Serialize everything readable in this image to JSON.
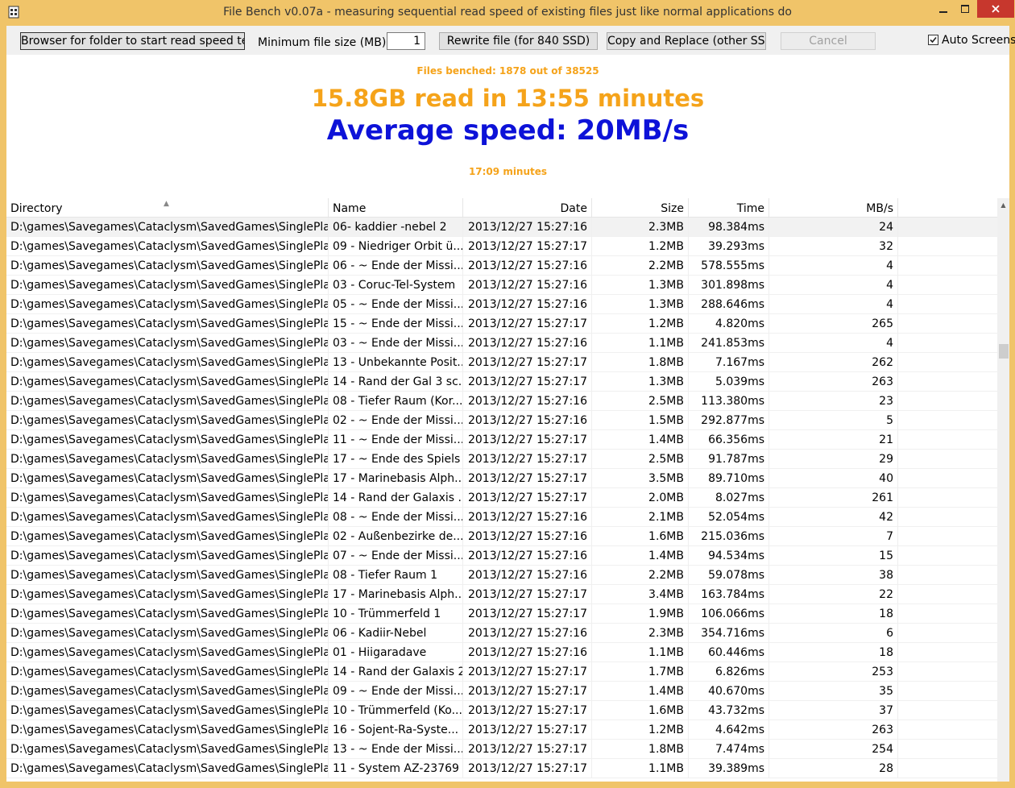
{
  "window": {
    "title": "File Bench v0.07a - measuring sequential read speed of existing files just like normal applications do"
  },
  "toolbar": {
    "browse_label": "Browser for folder to start read speed test.",
    "min_size_label": "Minimum file size (MB):",
    "min_size_value": "1",
    "rewrite_label": "Rewrite file (for 840 SSD)",
    "copy_replace_label": "Copy and Replace (other SSD)",
    "cancel_label": "Cancel",
    "auto_screens_label": "Auto Screens"
  },
  "stats": {
    "files_benched": "Files benched: 1878 out of 38525",
    "read_summary": "15.8GB read in  13:55 minutes",
    "average_speed": "Average speed: 20MB/s",
    "elapsed": "17:09 minutes"
  },
  "colors": {
    "accent_orange": "#f5a31a",
    "speed_blue": "#0d12d8",
    "titlebar": "#f0c469",
    "close_red": "#c7372d"
  },
  "table": {
    "columns": [
      "Directory",
      "Name",
      "Date",
      "Size",
      "Time",
      "MB/s"
    ],
    "rows": [
      [
        "D:\\games\\Savegames\\Cataclysm\\SavedGames\\SinglePlay...",
        "06- kaddier -nebel 2",
        "2013/12/27 15:27:16",
        "2.3MB",
        "98.384ms",
        "24"
      ],
      [
        "D:\\games\\Savegames\\Cataclysm\\SavedGames\\SinglePlay...",
        "09 - Niedriger Orbit ü...",
        "2013/12/27 15:27:17",
        "1.2MB",
        "39.293ms",
        "32"
      ],
      [
        "D:\\games\\Savegames\\Cataclysm\\SavedGames\\SinglePlay...",
        "06 - ~ Ende der Missi...",
        "2013/12/27 15:27:16",
        "2.2MB",
        "578.555ms",
        "4"
      ],
      [
        "D:\\games\\Savegames\\Cataclysm\\SavedGames\\SinglePlay...",
        "03 - Coruc-Tel-System",
        "2013/12/27 15:27:16",
        "1.3MB",
        "301.898ms",
        "4"
      ],
      [
        "D:\\games\\Savegames\\Cataclysm\\SavedGames\\SinglePlay...",
        "05 - ~ Ende der Missi...",
        "2013/12/27 15:27:16",
        "1.3MB",
        "288.646ms",
        "4"
      ],
      [
        "D:\\games\\Savegames\\Cataclysm\\SavedGames\\SinglePlay...",
        "15 - ~ Ende der Missi...",
        "2013/12/27 15:27:17",
        "1.2MB",
        "4.820ms",
        "265"
      ],
      [
        "D:\\games\\Savegames\\Cataclysm\\SavedGames\\SinglePlay...",
        "03 - ~ Ende der Missi...",
        "2013/12/27 15:27:16",
        "1.1MB",
        "241.853ms",
        "4"
      ],
      [
        "D:\\games\\Savegames\\Cataclysm\\SavedGames\\SinglePlay...",
        "13 - Unbekannte Posit...",
        "2013/12/27 15:27:17",
        "1.8MB",
        "7.167ms",
        "262"
      ],
      [
        "D:\\games\\Savegames\\Cataclysm\\SavedGames\\SinglePlay...",
        "14 - Rand der Gal 3 sc...",
        "2013/12/27 15:27:17",
        "1.3MB",
        "5.039ms",
        "263"
      ],
      [
        "D:\\games\\Savegames\\Cataclysm\\SavedGames\\SinglePlay...",
        "08 - Tiefer Raum (Kor...",
        "2013/12/27 15:27:16",
        "2.5MB",
        "113.380ms",
        "23"
      ],
      [
        "D:\\games\\Savegames\\Cataclysm\\SavedGames\\SinglePlay...",
        "02 - ~ Ende der Missi...",
        "2013/12/27 15:27:16",
        "1.5MB",
        "292.877ms",
        "5"
      ],
      [
        "D:\\games\\Savegames\\Cataclysm\\SavedGames\\SinglePlay...",
        "11 - ~ Ende der Missi...",
        "2013/12/27 15:27:17",
        "1.4MB",
        "66.356ms",
        "21"
      ],
      [
        "D:\\games\\Savegames\\Cataclysm\\SavedGames\\SinglePlay...",
        "17 - ~ Ende des Spiels",
        "2013/12/27 15:27:17",
        "2.5MB",
        "91.787ms",
        "29"
      ],
      [
        "D:\\games\\Savegames\\Cataclysm\\SavedGames\\SinglePlay...",
        "17 - Marinebasis Alph...",
        "2013/12/27 15:27:17",
        "3.5MB",
        "89.710ms",
        "40"
      ],
      [
        "D:\\games\\Savegames\\Cataclysm\\SavedGames\\SinglePlay...",
        "14 - Rand der Galaxis ...",
        "2013/12/27 15:27:17",
        "2.0MB",
        "8.027ms",
        "261"
      ],
      [
        "D:\\games\\Savegames\\Cataclysm\\SavedGames\\SinglePlay...",
        "08 - ~ Ende der Missi...",
        "2013/12/27 15:27:16",
        "2.1MB",
        "52.054ms",
        "42"
      ],
      [
        "D:\\games\\Savegames\\Cataclysm\\SavedGames\\SinglePlay...",
        "02 - Außenbezirke de...",
        "2013/12/27 15:27:16",
        "1.6MB",
        "215.036ms",
        "7"
      ],
      [
        "D:\\games\\Savegames\\Cataclysm\\SavedGames\\SinglePlay...",
        "07 - ~ Ende der Missi...",
        "2013/12/27 15:27:16",
        "1.4MB",
        "94.534ms",
        "15"
      ],
      [
        "D:\\games\\Savegames\\Cataclysm\\SavedGames\\SinglePlay...",
        "08 - Tiefer Raum 1",
        "2013/12/27 15:27:16",
        "2.2MB",
        "59.078ms",
        "38"
      ],
      [
        "D:\\games\\Savegames\\Cataclysm\\SavedGames\\SinglePlay...",
        "17 - Marinebasis Alph...",
        "2013/12/27 15:27:17",
        "3.4MB",
        "163.784ms",
        "22"
      ],
      [
        "D:\\games\\Savegames\\Cataclysm\\SavedGames\\SinglePlay...",
        "10 - Trümmerfeld 1",
        "2013/12/27 15:27:17",
        "1.9MB",
        "106.066ms",
        "18"
      ],
      [
        "D:\\games\\Savegames\\Cataclysm\\SavedGames\\SinglePlay...",
        "06 - Kadiir-Nebel",
        "2013/12/27 15:27:16",
        "2.3MB",
        "354.716ms",
        "6"
      ],
      [
        "D:\\games\\Savegames\\Cataclysm\\SavedGames\\SinglePlay...",
        "01 - Hiigaradave",
        "2013/12/27 15:27:16",
        "1.1MB",
        "60.446ms",
        "18"
      ],
      [
        "D:\\games\\Savegames\\Cataclysm\\SavedGames\\SinglePlay...",
        "14 - Rand der Galaxis 2",
        "2013/12/27 15:27:17",
        "1.7MB",
        "6.826ms",
        "253"
      ],
      [
        "D:\\games\\Savegames\\Cataclysm\\SavedGames\\SinglePlay...",
        "09 - ~ Ende der Missi...",
        "2013/12/27 15:27:17",
        "1.4MB",
        "40.670ms",
        "35"
      ],
      [
        "D:\\games\\Savegames\\Cataclysm\\SavedGames\\SinglePlay...",
        "10 - Trümmerfeld (Ko...",
        "2013/12/27 15:27:17",
        "1.6MB",
        "43.732ms",
        "37"
      ],
      [
        "D:\\games\\Savegames\\Cataclysm\\SavedGames\\SinglePlay...",
        "16 - Sojent-Ra-Syste...",
        "2013/12/27 15:27:17",
        "1.2MB",
        "4.642ms",
        "263"
      ],
      [
        "D:\\games\\Savegames\\Cataclysm\\SavedGames\\SinglePlay...",
        "13 - ~ Ende der Missi...",
        "2013/12/27 15:27:17",
        "1.8MB",
        "7.474ms",
        "254"
      ],
      [
        "D:\\games\\Savegames\\Cataclysm\\SavedGames\\SinglePlay...",
        "11 - System AZ-23769",
        "2013/12/27 15:27:17",
        "1.1MB",
        "39.389ms",
        "28"
      ]
    ]
  }
}
